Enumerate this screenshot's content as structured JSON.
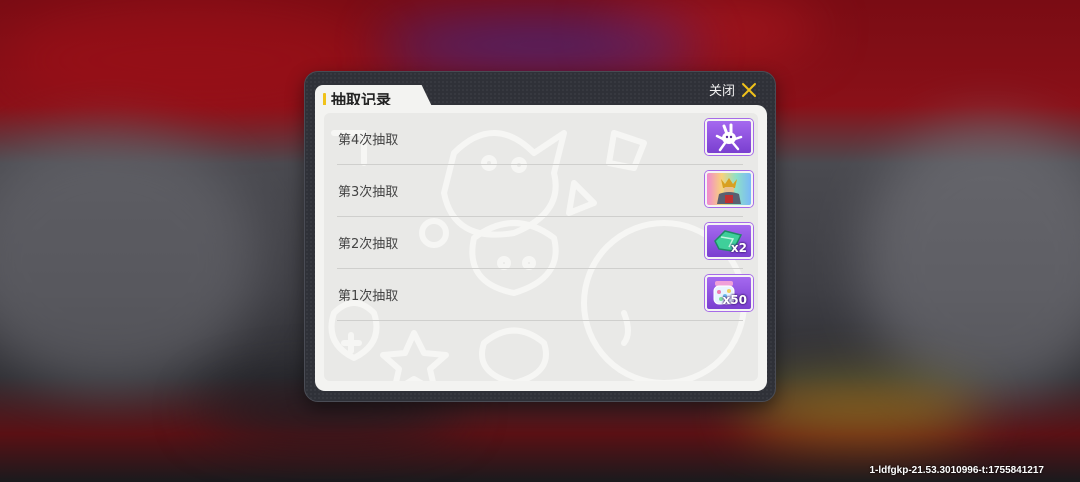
{
  "dialog": {
    "title": "抽取记录",
    "close_label": "关闭",
    "accent": "#f0c21a"
  },
  "records": [
    {
      "label": "第4次抽取",
      "item_icon": "bunny-figure-icon",
      "quantity": ""
    },
    {
      "label": "第3次抽取",
      "item_icon": "armored-figure-icon",
      "quantity": ""
    },
    {
      "label": "第2次抽取",
      "item_icon": "green-gem-icon",
      "quantity": "x2"
    },
    {
      "label": "第1次抽取",
      "item_icon": "candy-jar-icon",
      "quantity": "x50"
    }
  ],
  "watermark": "1-ldfgkp-21.53.3010996-t:1755841217"
}
